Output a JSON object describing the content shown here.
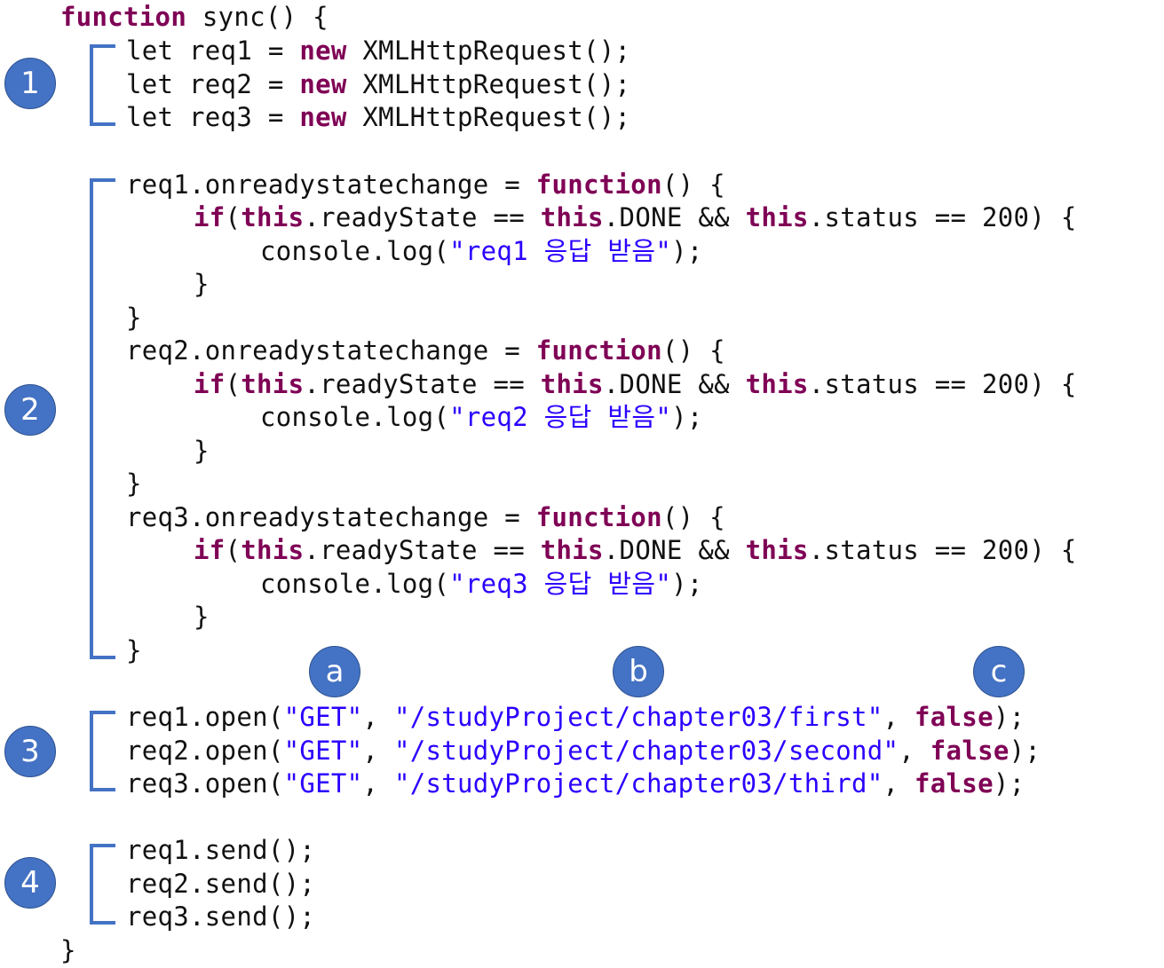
{
  "code": {
    "lines": [
      [
        {
          "t": "function",
          "c": "kw"
        },
        {
          "t": " sync() {",
          "c": ""
        }
      ],
      [
        {
          "t": "let req1 = ",
          "c": ""
        },
        {
          "t": "new",
          "c": "kw"
        },
        {
          "t": " XMLHttpRequest();",
          "c": ""
        }
      ],
      [
        {
          "t": "let req2 = ",
          "c": ""
        },
        {
          "t": "new",
          "c": "kw"
        },
        {
          "t": " XMLHttpRequest();",
          "c": ""
        }
      ],
      [
        {
          "t": "let req3 = ",
          "c": ""
        },
        {
          "t": "new",
          "c": "kw"
        },
        {
          "t": " XMLHttpRequest();",
          "c": ""
        }
      ],
      [
        {
          "t": "req1.onreadystatechange = ",
          "c": ""
        },
        {
          "t": "function",
          "c": "kw"
        },
        {
          "t": "() {",
          "c": ""
        }
      ],
      [
        {
          "t": "if",
          "c": "kw"
        },
        {
          "t": "(",
          "c": ""
        },
        {
          "t": "this",
          "c": "kw"
        },
        {
          "t": ".readyState == ",
          "c": ""
        },
        {
          "t": "this",
          "c": "kw"
        },
        {
          "t": ".DONE && ",
          "c": ""
        },
        {
          "t": "this",
          "c": "kw"
        },
        {
          "t": ".status == 200) {",
          "c": ""
        }
      ],
      [
        {
          "t": "console.log(",
          "c": ""
        },
        {
          "t": "\"req1 응답 받음\"",
          "c": "str"
        },
        {
          "t": ");",
          "c": ""
        }
      ],
      [
        {
          "t": "}",
          "c": ""
        }
      ],
      [
        {
          "t": "}",
          "c": ""
        }
      ],
      [
        {
          "t": "req2.onreadystatechange = ",
          "c": ""
        },
        {
          "t": "function",
          "c": "kw"
        },
        {
          "t": "() {",
          "c": ""
        }
      ],
      [
        {
          "t": "if",
          "c": "kw"
        },
        {
          "t": "(",
          "c": ""
        },
        {
          "t": "this",
          "c": "kw"
        },
        {
          "t": ".readyState == ",
          "c": ""
        },
        {
          "t": "this",
          "c": "kw"
        },
        {
          "t": ".DONE && ",
          "c": ""
        },
        {
          "t": "this",
          "c": "kw"
        },
        {
          "t": ".status == 200) {",
          "c": ""
        }
      ],
      [
        {
          "t": "console.log(",
          "c": ""
        },
        {
          "t": "\"req2 응답 받음\"",
          "c": "str"
        },
        {
          "t": ");",
          "c": ""
        }
      ],
      [
        {
          "t": "}",
          "c": ""
        }
      ],
      [
        {
          "t": "}",
          "c": ""
        }
      ],
      [
        {
          "t": "req3.onreadystatechange = ",
          "c": ""
        },
        {
          "t": "function",
          "c": "kw"
        },
        {
          "t": "() {",
          "c": ""
        }
      ],
      [
        {
          "t": "if",
          "c": "kw"
        },
        {
          "t": "(",
          "c": ""
        },
        {
          "t": "this",
          "c": "kw"
        },
        {
          "t": ".readyState == ",
          "c": ""
        },
        {
          "t": "this",
          "c": "kw"
        },
        {
          "t": ".DONE && ",
          "c": ""
        },
        {
          "t": "this",
          "c": "kw"
        },
        {
          "t": ".status == 200) {",
          "c": ""
        }
      ],
      [
        {
          "t": "console.log(",
          "c": ""
        },
        {
          "t": "\"req3 응답 받음\"",
          "c": "str"
        },
        {
          "t": ");",
          "c": ""
        }
      ],
      [
        {
          "t": "}",
          "c": ""
        }
      ],
      [
        {
          "t": "}",
          "c": ""
        }
      ],
      [
        {
          "t": "req1.open(",
          "c": ""
        },
        {
          "t": "\"GET\"",
          "c": "str"
        },
        {
          "t": ", ",
          "c": ""
        },
        {
          "t": "\"/studyProject/chapter03/first\"",
          "c": "str"
        },
        {
          "t": ", ",
          "c": ""
        },
        {
          "t": "false",
          "c": "kw"
        },
        {
          "t": ");",
          "c": ""
        }
      ],
      [
        {
          "t": "req2.open(",
          "c": ""
        },
        {
          "t": "\"GET\"",
          "c": "str"
        },
        {
          "t": ", ",
          "c": ""
        },
        {
          "t": "\"/studyProject/chapter03/second\"",
          "c": "str"
        },
        {
          "t": ", ",
          "c": ""
        },
        {
          "t": "false",
          "c": "kw"
        },
        {
          "t": ");",
          "c": ""
        }
      ],
      [
        {
          "t": "req3.open(",
          "c": ""
        },
        {
          "t": "\"GET\"",
          "c": "str"
        },
        {
          "t": ", ",
          "c": ""
        },
        {
          "t": "\"/studyProject/chapter03/third\"",
          "c": "str"
        },
        {
          "t": ", ",
          "c": ""
        },
        {
          "t": "false",
          "c": "kw"
        },
        {
          "t": ");",
          "c": ""
        }
      ],
      [
        {
          "t": "req1.send();",
          "c": ""
        }
      ],
      [
        {
          "t": "req2.send();",
          "c": ""
        }
      ],
      [
        {
          "t": "req3.send();",
          "c": ""
        }
      ],
      [
        {
          "t": "}",
          "c": ""
        }
      ]
    ]
  },
  "sections": [
    {
      "label": "1"
    },
    {
      "label": "2"
    },
    {
      "label": "3"
    },
    {
      "label": "4"
    }
  ],
  "args": [
    {
      "label": "a"
    },
    {
      "label": "b"
    },
    {
      "label": "c"
    }
  ],
  "colors": {
    "keyword": "#7f0055",
    "string": "#2a00ff",
    "text": "#111111",
    "badge": "#4472c4",
    "bracket": "#4472c4"
  }
}
